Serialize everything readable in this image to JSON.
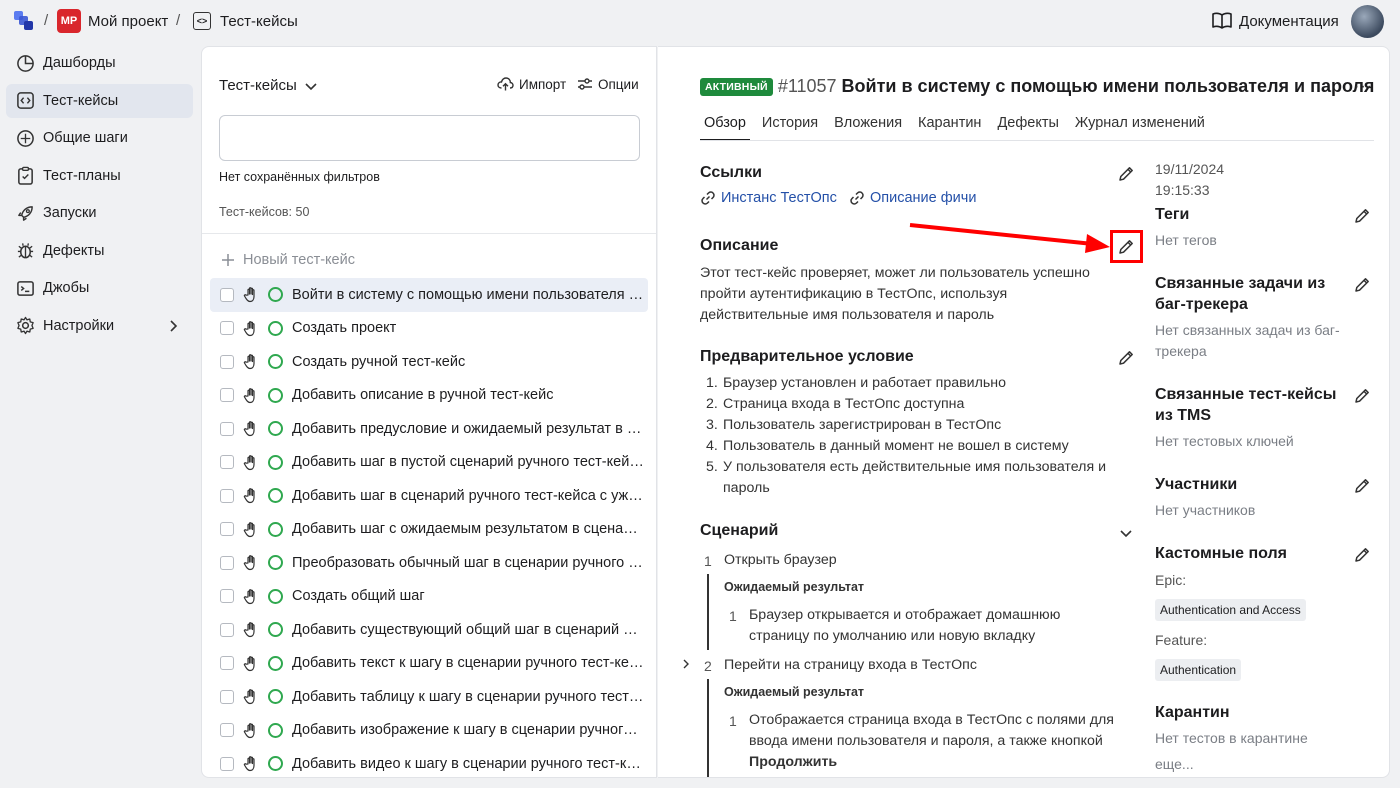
{
  "breadcrumb": {
    "separator": "/",
    "project_initials": "MP",
    "project_name": "Мой проект",
    "section": "Тест-кейсы"
  },
  "header": {
    "docs_label": "Документация"
  },
  "sidebar": {
    "items": [
      {
        "label": "Дашборды"
      },
      {
        "label": "Тест-кейсы"
      },
      {
        "label": "Общие шаги"
      },
      {
        "label": "Тест-планы"
      },
      {
        "label": "Запуски"
      },
      {
        "label": "Дефекты"
      },
      {
        "label": "Джобы"
      },
      {
        "label": "Настройки"
      }
    ]
  },
  "list_panel": {
    "title": "Тест-кейсы",
    "import_label": "Импорт",
    "options_label": "Опции",
    "filter_value": "",
    "no_filters": "Нет сохранённых фильтров",
    "count_text": "Тест-кейсов: 50",
    "new_label": "Новый тест-кейс",
    "rows": [
      "Войти в систему с помощью имени пользователя и пароля",
      "Создать проект",
      "Создать ручной тест-кейс",
      "Добавить описание в ручной тест-кейс",
      "Добавить предусловие и ожидаемый результат в ручной тест-кейс",
      "Добавить шаг в пустой сценарий ручного тест-кейса",
      "Добавить шаг в сценарий ручного тест-кейса с уже существующими шагами",
      "Добавить шаг с ожидаемым результатом в сценарий ручного тест-кейса",
      "Преобразовать обычный шаг в сценарии ручного тест-кейса в общий шаг",
      "Создать общий шаг",
      "Добавить существующий общий шаг в сценарий ручного тест-кейса",
      "Добавить текст к шагу в сценарии ручного тест-кейса",
      "Добавить таблицу к шагу в сценарии ручного тест-кейса",
      "Добавить изображение к шагу в сценарии ручного тест-кейса",
      "Добавить видео к шагу в сценарии ручного тест-кейса"
    ]
  },
  "detail": {
    "status": "АКТИВНЫЙ",
    "id": "#11057",
    "title": "Войти в систему с помощью имени пользователя и пароля",
    "more": "···",
    "tabs": [
      "Обзор",
      "История",
      "Вложения",
      "Карантин",
      "Дефекты",
      "Журнал изменений"
    ],
    "links_title": "Ссылки",
    "links": [
      "Инстанс ТестОпс",
      "Описание фичи"
    ],
    "description_title": "Описание",
    "description": "Этот тест-кейс проверяет, может ли пользователь успешно пройти аутентификацию в ТестОпс, используя действительные имя пользователя и пароль",
    "precondition_title": "Предварительное условие",
    "preconditions": [
      {
        "n": "1.",
        "text": "Браузер установлен и работает правильно"
      },
      {
        "n": "2.",
        "text": "Страница входа в ТестОпс доступна"
      },
      {
        "n": "3.",
        "text": "Пользователь зарегистрирован в ТестОпс"
      },
      {
        "n": "4.",
        "text": "Пользователь в данный момент не вошел в систему"
      },
      {
        "n": "5.",
        "text": "У пользователя есть действительные имя пользователя и пароль"
      }
    ],
    "scenario_title": "Сценарий",
    "steps": [
      {
        "n": "1",
        "text": "Открыть браузер",
        "expected_label": "Ожидаемый результат",
        "expected_n": "1",
        "expected": "Браузер открывается и отображает домашнюю страницу по умолчанию или новую вкладку"
      },
      {
        "n": "2",
        "text": "Перейти на страницу входа в ТестОпс",
        "expected_label": "Ожидаемый результат",
        "expected_n": "1",
        "expected": "Отображается страница входа в ТестОпс с полями для ввода имени пользователя и пароля, а также кнопкой",
        "expected_bold": "Продолжить"
      }
    ],
    "meta": {
      "date": "19/11/2024",
      "time": "19:15:33",
      "tags_title": "Теги",
      "tags_value": "Нет тегов",
      "issues_title": "Связанные задачи из баг-трекера",
      "issues_value": "Нет связанных задач из баг-трекера",
      "tms_title": "Связанные тест-кейсы из TMS",
      "tms_value": "Нет тестовых ключей",
      "members_title": "Участники",
      "members_value": "Нет участников",
      "custom_title": "Кастомные поля",
      "epic_label": "Epic:",
      "epic_value": "Authentication and Access",
      "feature_label": "Feature:",
      "feature_value": "Authentication",
      "quarantine_title": "Карантин",
      "quarantine_value": "Нет тестов в карантине",
      "quarantine_more": "еще..."
    }
  },
  "colors": {
    "accent_link": "#2450a8",
    "status_active": "#1e8a3c",
    "status_ring": "#2fa84f",
    "annotation": "#ff0000",
    "project_badge": "#d9262c"
  }
}
